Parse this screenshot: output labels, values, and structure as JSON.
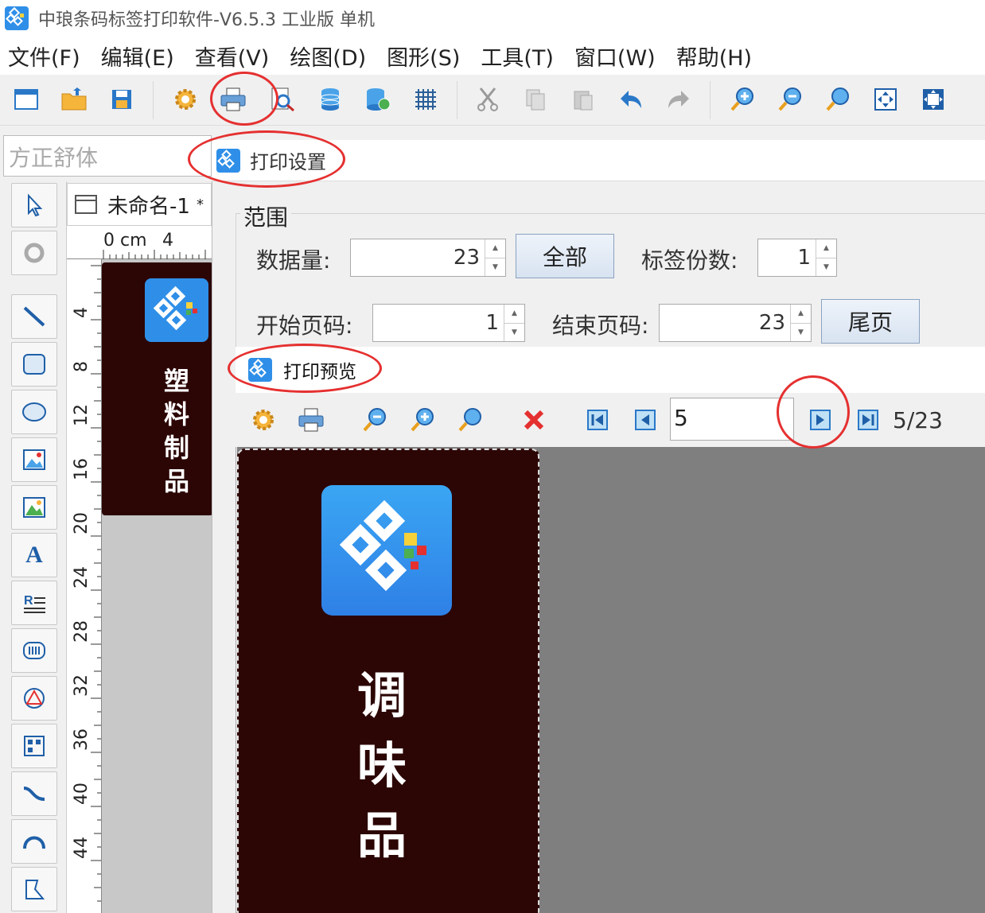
{
  "window": {
    "title": "中琅条码标签打印软件-V6.5.3 工业版 单机"
  },
  "menu": {
    "items": [
      "文件(F)",
      "编辑(E)",
      "查看(V)",
      "绘图(D)",
      "图形(S)",
      "工具(T)",
      "窗口(W)",
      "帮助(H)"
    ]
  },
  "font_box": {
    "value": "方正舒体"
  },
  "document": {
    "tab_label": "未命名-1",
    "tab_mark": "*",
    "ruler_unit": "0 cm",
    "ruler_h_mark": "4",
    "ruler_v_marks": [
      "4",
      "8",
      "12",
      "16",
      "20",
      "24",
      "28",
      "32",
      "36",
      "40",
      "44"
    ]
  },
  "small_label": {
    "chars": [
      "塑",
      "料",
      "制",
      "品"
    ]
  },
  "print_settings": {
    "title": "打印设置",
    "range_group": "范围",
    "data_count_label": "数据量:",
    "data_count_value": "23",
    "all_button": "全部",
    "copies_label": "标签份数:",
    "copies_value": "1",
    "start_page_label": "开始页码:",
    "start_page_value": "1",
    "end_page_label": "结束页码:",
    "end_page_value": "23",
    "last_page_button": "尾页"
  },
  "preview": {
    "title": "打印预览",
    "page_input": "5",
    "page_count": "5/23",
    "label_chars": [
      "调",
      "味",
      "品"
    ]
  },
  "colors": {
    "label_bg": "#2c0505",
    "accent": "#2f8fe8",
    "highlight": "#e53030"
  }
}
